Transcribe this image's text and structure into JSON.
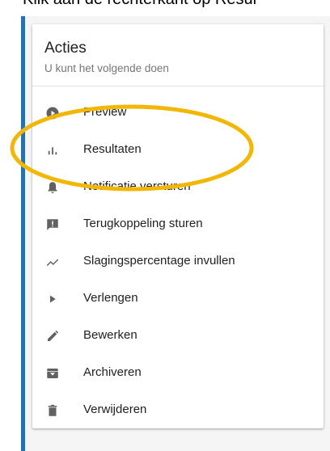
{
  "instruction": "Klik aan de rechterkant op Resul",
  "card": {
    "title": "Acties",
    "subtitle": "U kunt het volgende doen"
  },
  "actions": [
    {
      "label": "Preview",
      "icon": "play-circle-icon"
    },
    {
      "label": "Resultaten",
      "icon": "bar-chart-icon"
    },
    {
      "label": "Notificatie versturen",
      "icon": "bell-icon"
    },
    {
      "label": "Terugkoppeling sturen",
      "icon": "feedback-icon"
    },
    {
      "label": "Slagingspercentage invullen",
      "icon": "trending-icon"
    },
    {
      "label": "Verlengen",
      "icon": "play-arrow-icon"
    },
    {
      "label": "Bewerken",
      "icon": "pencil-icon"
    },
    {
      "label": "Archiveren",
      "icon": "archive-icon"
    },
    {
      "label": "Verwijderen",
      "icon": "trash-icon"
    }
  ],
  "colors": {
    "highlight_ring": "#f2b705",
    "left_rule": "#2a6fb0",
    "icon": "#616161"
  }
}
